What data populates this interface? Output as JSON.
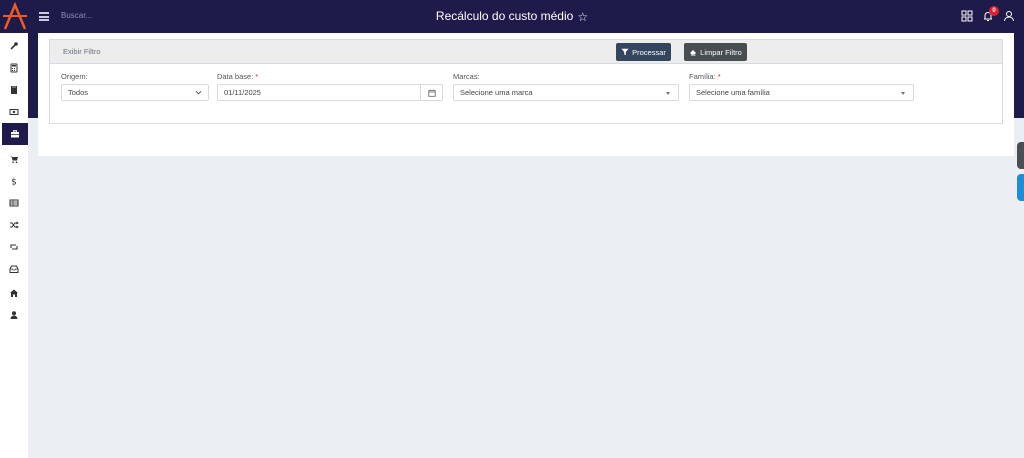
{
  "header": {
    "search_placeholder": "Buscar...",
    "title": "Recálculo do custo médio",
    "notification_count": "0"
  },
  "sidebar": {
    "items": [
      {
        "icon": "wrench-icon"
      },
      {
        "icon": "calculator-icon"
      },
      {
        "icon": "book-icon"
      },
      {
        "icon": "money-bill-icon"
      },
      {
        "icon": "briefcase-icon",
        "active": true
      },
      {
        "icon": "cart-icon"
      },
      {
        "icon": "dollar-icon"
      },
      {
        "icon": "table-icon"
      },
      {
        "icon": "shuffle-icon"
      },
      {
        "icon": "retweet-icon"
      },
      {
        "icon": "inbox-icon"
      },
      {
        "icon": "home-icon"
      },
      {
        "icon": "user-icon"
      }
    ]
  },
  "filter": {
    "header_label": "Exibir Filtro",
    "process_label": "Processar",
    "clear_label": "Limpar Filtro",
    "origem": {
      "label": "Origem:",
      "value": "Todos"
    },
    "data_base": {
      "label": "Data base:",
      "required": "*",
      "value": "01/11/2025"
    },
    "marcas": {
      "label": "Marcas:",
      "placeholder": "Selecione uma marca"
    },
    "familia": {
      "label": "Família:",
      "required": "*",
      "placeholder": "Selecione uma família"
    }
  },
  "colors": {
    "primary": "#1e1b4b",
    "accent_orange": "#ef5a24",
    "process_button": "#34455e",
    "clear_button": "#484d52",
    "badge": "#e11d2e"
  }
}
